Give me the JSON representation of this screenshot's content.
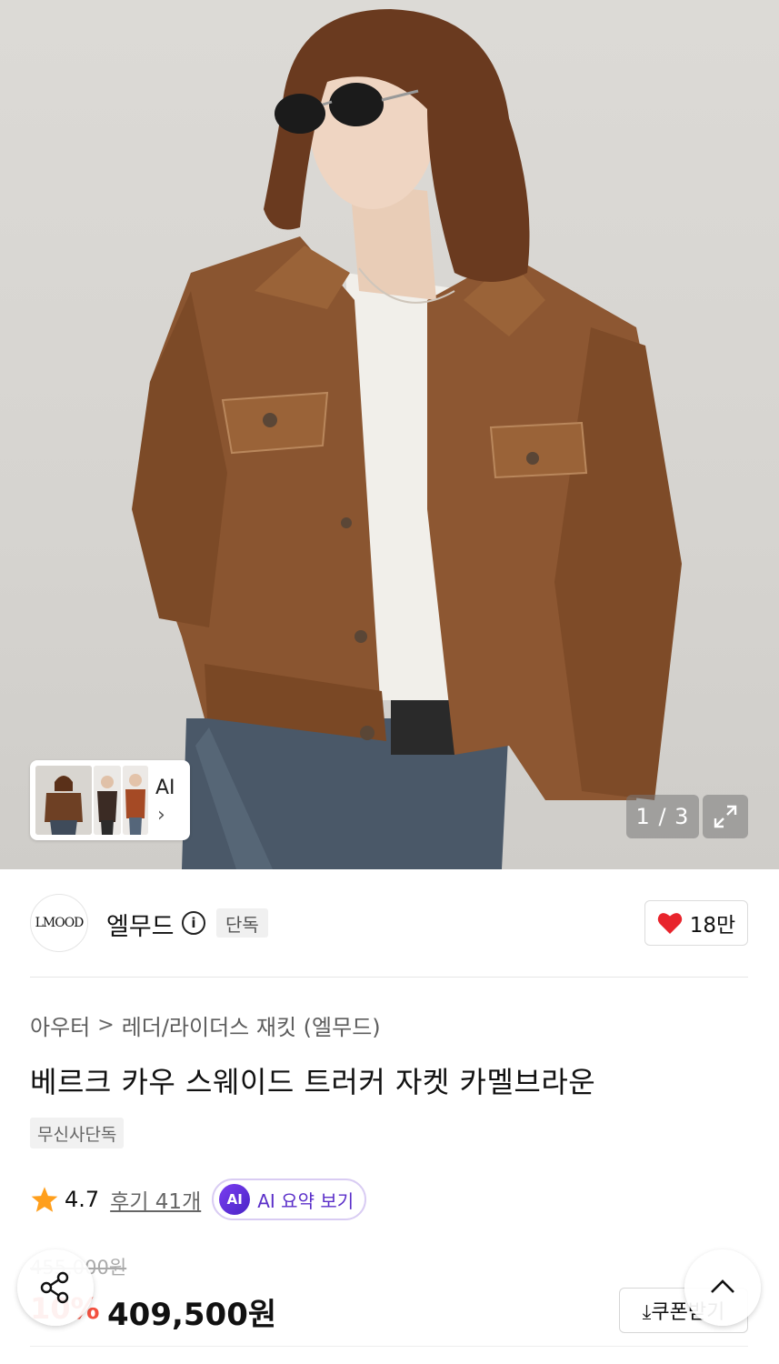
{
  "gallery": {
    "thumbs_ai_label": "AI",
    "thumbs_chevron": "›",
    "counter": "1 / 3",
    "expand_icon": "expand-icon"
  },
  "brand": {
    "logo_text": "LMOOD",
    "name": "엘무드",
    "info_icon": "i",
    "badge": "단독",
    "likes": "18만"
  },
  "breadcrumb": {
    "items": [
      "아우터",
      "레더/라이더스 재킷 (엘무드)"
    ],
    "separator": ">"
  },
  "product": {
    "title": "베르크 카우 스웨이드 트러커 자켓 카멜브라운",
    "tag": "무신사단독",
    "rating": "4.7",
    "reviews": "후기 41개",
    "ai_badge": "AI",
    "ai_summary": "AI 요약 보기",
    "original_price": "455,000원",
    "discount": "10%",
    "price": "409,500원"
  },
  "actions": {
    "coupon": "⤓쿠폰받기"
  },
  "colors": {
    "heart": "#e8242c",
    "discount": "#f3503f",
    "ai_purple": "#5b2fc9",
    "star": "#ff9f1c"
  }
}
